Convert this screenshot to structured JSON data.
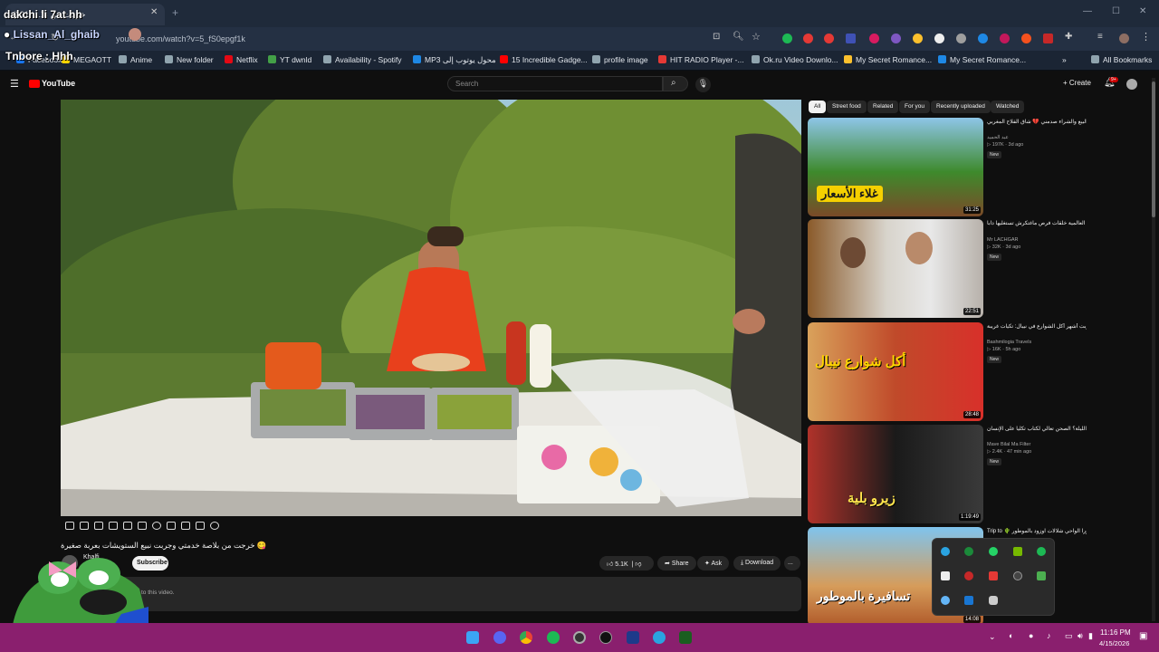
{
  "browser": {
    "tab_title": "خرجت من بلا... (291)",
    "new_tab": "+",
    "url": "youtube.com/watch?v=5_fS0epgf1k",
    "bookmarks": [
      "Facebook",
      "MEGAOTT",
      "Anime",
      "New folder",
      "Netflix",
      "YT  dwnld",
      "Availability - Spotify",
      "MP3 محول يوتوب إلى",
      "15 Incredible Gadge...",
      "profile image",
      "HIT RADIO Player -...",
      "Ok.ru Video Downlo...",
      "My Secret Romance...",
      "My Secret Romance..."
    ],
    "bookmarks_more": "»",
    "all_bookmarks": "All Bookmarks"
  },
  "overlay": {
    "line1": "dakchi li 7at hh",
    "line2": "Lissan_Al_ghaib",
    "line3": "Tnbore : Hhh"
  },
  "youtube": {
    "logo": "YouTube",
    "search_placeholder": "Search",
    "create": "Create",
    "notif_count": "9+",
    "video_title": "خرجت من بلاصة خدمتي وجربت نبيع الستويشات بعربة صغيرة 😋",
    "channel": "Khalfi",
    "subscribe": "Subscribe",
    "likes": "5.1K",
    "share": "Share",
    "ask": "Ask",
    "download": "Download",
    "more": "...",
    "desc_snippet": "to this video.",
    "chips": [
      "All",
      "Street food",
      "Related",
      "For you",
      "Recently uploaded",
      "Watched"
    ],
    "recommendations": [
      {
        "title": "شحت يوماً مع الفلاحة 🧅 ... الفرق الكبير بين ثمن البيع والشراء صدمني 💔 شاق الفلاح المغربي...",
        "channel": "عبد الحميد",
        "views": "197K",
        "age": "3d ago",
        "badge": "New",
        "duration": "31:25",
        "thumb_text": "غلاء الأسعار"
      },
      {
        "title": "ها فين كتلقين الفلوس دابا — الأزمة العالمية خلقات فرص ماغتكرش تستغليها دابا !!",
        "channel": "Mr LACHGAR",
        "views": "32K",
        "age": "3d ago",
        "badge": "New",
        "duration": "22:51",
        "thumb_text": ""
      },
      {
        "title": "جربت أشهر أكل الشوارع في نيبال: تكيات غريبة !",
        "channel": "Bashmilogia Travels",
        "views": "16K",
        "age": "5h ago",
        "badge": "New",
        "duration": "28:48",
        "thumb_text": "أكل شوارع نيبال"
      },
      {
        "title": "كيفاش تحس الليلة؟ الصحن تعالي لكتاب تكليا على الإنسان | Zero Blya",
        "channel": "Mave Bilal Ma Filter",
        "views": "2.4K",
        "age": "47 min ago",
        "badge": "New",
        "duration": "1:19:49",
        "thumb_text": "زيرو بلية"
      },
      {
        "title": "Trip to 🌵 ديورا الواحي شلالات اوزود بالموطور",
        "channel": "",
        "views": "",
        "age": "",
        "badge": "",
        "duration": "14:08",
        "thumb_text": "تسافيرة بالموطور"
      }
    ]
  },
  "taskbar": {
    "time": "11:16 PM",
    "date": "4/15/2026"
  },
  "colors": {
    "taskbar": "#8a1f6e",
    "yt_red": "#ff0000",
    "bg": "#0f0f0f"
  }
}
